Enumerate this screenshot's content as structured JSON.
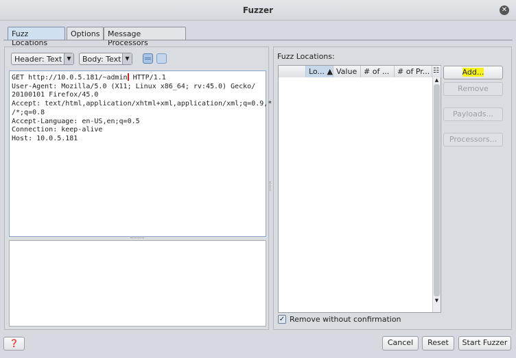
{
  "window": {
    "title": "Fuzzer"
  },
  "tabs": [
    {
      "label": "Fuzz Locations"
    },
    {
      "label": "Options"
    },
    {
      "label": "Message Processors"
    }
  ],
  "editor": {
    "header_view": "Header: Text",
    "body_view": "Body: Text",
    "request_before_caret": "GET http://10.0.5.181/~admin",
    "request_after_caret": " HTTP/1.1\nUser-Agent: Mozilla/5.0 (X11; Linux x86_64; rv:45.0) Gecko/\n20100101 Firefox/45.0\nAccept: text/html,application/xhtml+xml,application/xml;q=0.9,*\n/*;q=0.8\nAccept-Language: en-US,en;q=0.5\nConnection: keep-alive\nHost: 10.0.5.181"
  },
  "fuzz_locations": {
    "label": "Fuzz Locations:",
    "columns": [
      "",
      "Lo... ▲",
      "Value",
      "# of ...",
      "# of Pr..."
    ],
    "buttons": {
      "add": "Add...",
      "remove": "Remove",
      "payloads": "Payloads...",
      "processors": "Processors..."
    },
    "remove_without_confirmation": {
      "label": "Remove without confirmation",
      "checked": true
    }
  },
  "footer": {
    "cancel": "Cancel",
    "reset": "Reset",
    "start": "Start Fuzzer"
  },
  "colors": {
    "highlight": "#f5f21a"
  }
}
